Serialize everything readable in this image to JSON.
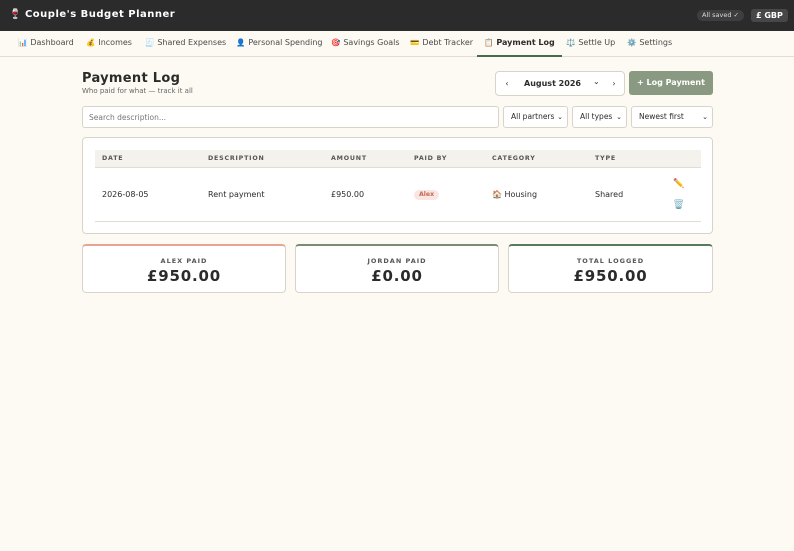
{
  "app": {
    "logo_icon": "🍷",
    "title": "Couple's Budget Planner",
    "saved_status": "All saved ✓",
    "currency": "£ GBP"
  },
  "nav": [
    {
      "icon": "📊",
      "label": "Dashboard"
    },
    {
      "icon": "💰",
      "label": "Incomes"
    },
    {
      "icon": "🧾",
      "label": "Shared Expenses"
    },
    {
      "icon": "👤",
      "label": "Personal Spending"
    },
    {
      "icon": "🎯",
      "label": "Savings Goals"
    },
    {
      "icon": "💳",
      "label": "Debt Tracker"
    },
    {
      "icon": "📋",
      "label": "Payment Log"
    },
    {
      "icon": "⚖️",
      "label": "Settle Up"
    },
    {
      "icon": "⚙️",
      "label": "Settings"
    }
  ],
  "page": {
    "title": "Payment Log",
    "subtitle": "Who paid for what — track it all"
  },
  "month_picker": {
    "prev": "‹",
    "next": "›",
    "value": "August 2026",
    "dropdown": "⌄"
  },
  "log_button": "+ Log Payment",
  "filters": {
    "search_placeholder": "Search description...",
    "partner": "All partners",
    "type": "All types",
    "sort": "Newest first",
    "chevron": "⌄"
  },
  "table": {
    "headers": [
      "DATE",
      "DESCRIPTION",
      "AMOUNT",
      "PAID BY",
      "CATEGORY",
      "TYPE"
    ],
    "rows": [
      {
        "date": "2026-08-05",
        "description": "Rent payment",
        "amount": "£950.00",
        "paid_by": "Alex",
        "category_icon": "🏠",
        "category": "Housing",
        "type": "Shared",
        "edit_icon": "✏️",
        "delete_icon": "🗑️"
      }
    ]
  },
  "stats": [
    {
      "label": "ALEX PAID",
      "value": "£950.00",
      "accent": "#e8a395"
    },
    {
      "label": "JORDAN PAID",
      "value": "£0.00",
      "accent": "#7a8c74"
    },
    {
      "label": "TOTAL LOGGED",
      "value": "£950.00",
      "accent": "#5a7a5e"
    }
  ],
  "colors": {
    "topbar": "#2b2b2b",
    "primary_button": "#8a9a82",
    "active_tab_underline": "#4a6a4e",
    "alex_badge": "#c56a55"
  }
}
